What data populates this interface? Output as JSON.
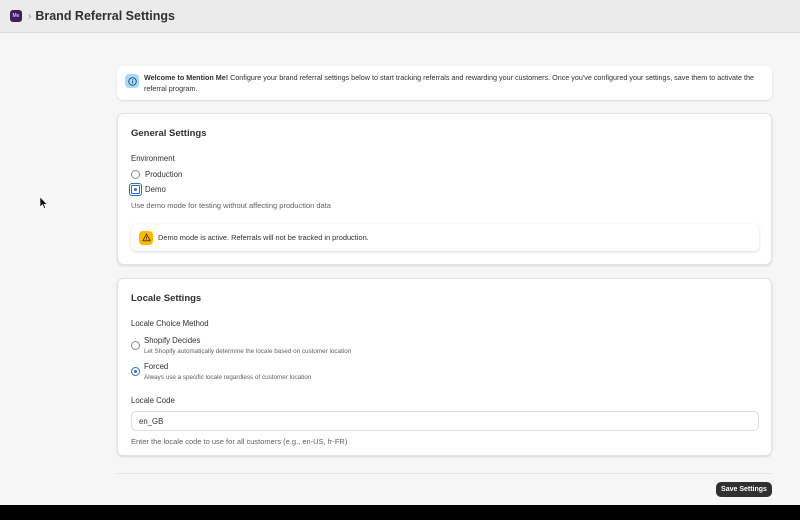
{
  "header": {
    "app_icon_text": "Me",
    "title": "Brand Referral Settings"
  },
  "banner": {
    "bold": "Welcome to Mention Me!",
    "text": " Configure your brand referral settings below to start tracking referrals and rewarding your customers. Once you've configured your settings, save them to activate the referral program."
  },
  "general": {
    "title": "General Settings",
    "environment_label": "Environment",
    "options": [
      "Production",
      "Demo"
    ],
    "selected": "Demo",
    "help": "Use demo mode for testing without affecting production data",
    "warning": "Demo mode is active. Referrals will not be tracked in production."
  },
  "locale": {
    "title": "Locale Settings",
    "method_label": "Locale Choice Method",
    "options": [
      {
        "label": "Shopify Decides",
        "description": "Let Shopify automatically determine the locale based on customer location"
      },
      {
        "label": "Forced",
        "description": "Always use a specific locale regardless of customer location"
      }
    ],
    "selected": "Forced",
    "code_label": "Locale Code",
    "code_value": "en_GB",
    "code_help": "Enter the locale code to use for all customers (e.g., en-US, fr-FR)"
  },
  "actions": {
    "save_label": "Save Settings"
  },
  "colors": {
    "accent": "#2c6ecb",
    "warning": "#ffb800",
    "info": "#a8d8f5",
    "primary_button": "#303030"
  }
}
